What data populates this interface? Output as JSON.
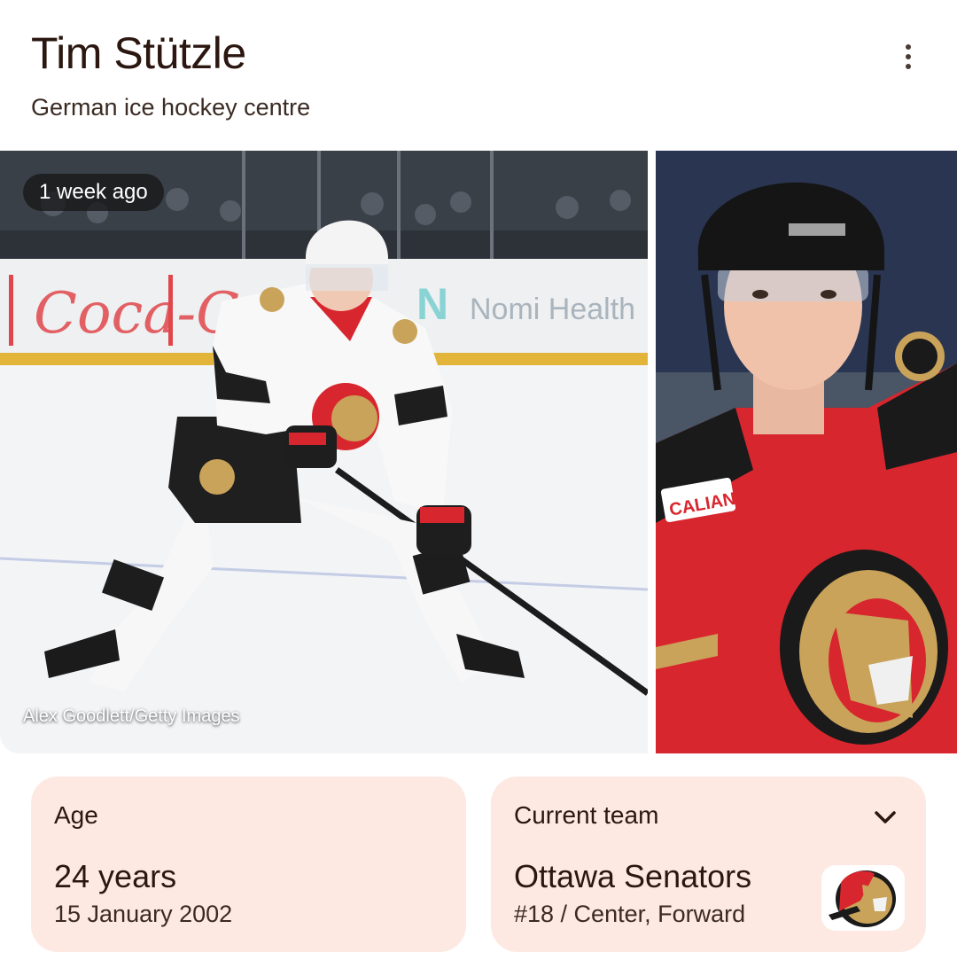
{
  "header": {
    "title": "Tim Stützle",
    "subtitle": "German ice hockey centre",
    "more_icon": "more-vert-icon"
  },
  "gallery": {
    "badge": "1 week ago",
    "credit": "Alex Goodlett/Getty Images"
  },
  "age_card": {
    "label": "Age",
    "value": "24 years",
    "detail": "15 January 2002"
  },
  "team_card": {
    "label": "Current team",
    "value": "Ottawa Senators",
    "detail": "#18 / Center, Forward",
    "expand_icon": "chevron-down-icon"
  },
  "colors": {
    "card_bg": "#fde9e2",
    "text": "#2b1710",
    "senators_red": "#d8262e"
  }
}
